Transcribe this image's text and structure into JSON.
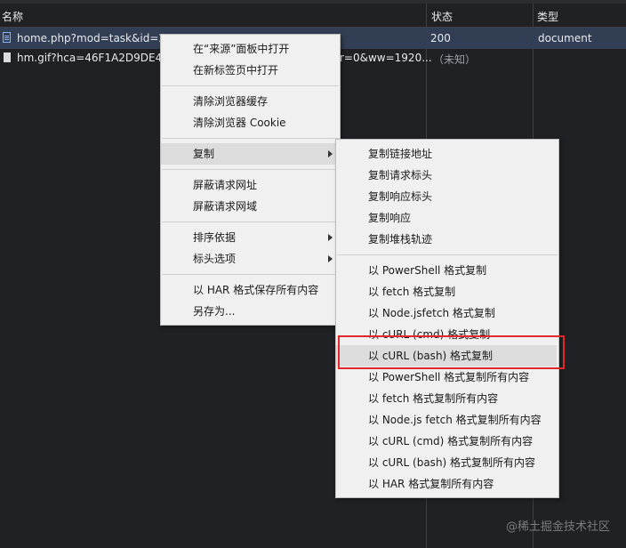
{
  "header": {
    "name_col": "名称",
    "status_col": "状态",
    "type_col": "类型"
  },
  "rows": [
    {
      "name": "home.php?mod=task&id=2&",
      "name_tail": "",
      "status": "200",
      "type": "document"
    },
    {
      "name": "hm.gif?hca=46F1A2D9DE4F59",
      "name_tail": "r=0&ww=1920...",
      "status": "（未知）",
      "type": ""
    }
  ],
  "menu": {
    "items": [
      "在“来源”面板中打开",
      "在新标签页中打开",
      "清除浏览器缓存",
      "清除浏览器 Cookie",
      "复制",
      "屏蔽请求网址",
      "屏蔽请求网域",
      "排序依据",
      "标头选项",
      "以 HAR 格式保存所有内容",
      "另存为..."
    ]
  },
  "submenu": {
    "items": [
      "复制链接地址",
      "复制请求标头",
      "复制响应标头",
      "复制响应",
      "复制堆栈轨迹",
      "以 PowerShell 格式复制",
      "以 fetch 格式复制",
      "以 Node.jsfetch 格式复制",
      "以 cURL (cmd) 格式复制",
      "以 cURL (bash) 格式复制",
      "以 PowerShell 格式复制所有内容",
      "以 fetch 格式复制所有内容",
      "以 Node.js fetch 格式复制所有内容",
      "以 cURL (cmd) 格式复制所有内容",
      "以 cURL (bash) 格式复制所有内容",
      "以 HAR 格式复制所有内容"
    ]
  },
  "watermark": "@稀土掘金技术社区",
  "colors": {
    "selected_row": "#323e54",
    "highlight_border": "#e0282a",
    "menu_bg": "#f0f0f0"
  }
}
